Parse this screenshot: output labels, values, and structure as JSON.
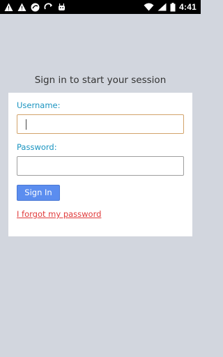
{
  "status_bar": {
    "time": "4:41",
    "left_icons": [
      "notification-icon",
      "warning-icon",
      "app-icon",
      "rotate-icon",
      "android-icon"
    ],
    "right_icons": [
      "wifi-icon",
      "signal-icon",
      "battery-icon"
    ]
  },
  "login": {
    "title": "Sign in to start your session",
    "username_label": "Username:",
    "username_value": "",
    "password_label": "Password:",
    "password_value": "",
    "signin_label": "Sign In",
    "forgot_label": "I forgot my password"
  },
  "colors": {
    "background": "#d2d6de",
    "label": "#1a94c0",
    "button": "#5b8def",
    "link": "#e03b3b"
  }
}
